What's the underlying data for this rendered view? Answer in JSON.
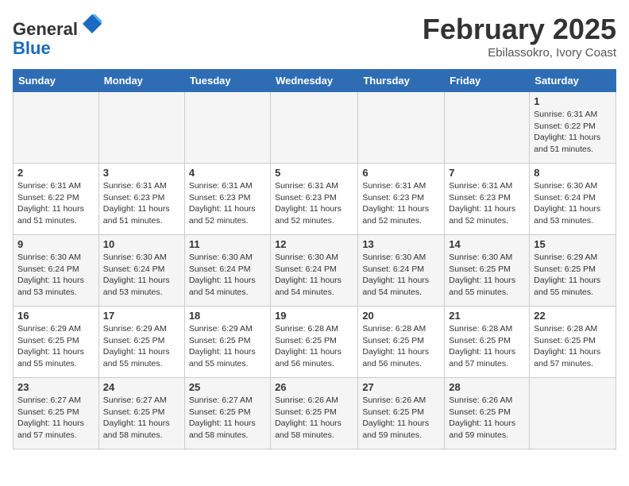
{
  "header": {
    "logo_general": "General",
    "logo_blue": "Blue",
    "month_year": "February 2025",
    "location": "Ebilassokro, Ivory Coast"
  },
  "weekdays": [
    "Sunday",
    "Monday",
    "Tuesday",
    "Wednesday",
    "Thursday",
    "Friday",
    "Saturday"
  ],
  "weeks": [
    [
      {
        "day": "",
        "info": ""
      },
      {
        "day": "",
        "info": ""
      },
      {
        "day": "",
        "info": ""
      },
      {
        "day": "",
        "info": ""
      },
      {
        "day": "",
        "info": ""
      },
      {
        "day": "",
        "info": ""
      },
      {
        "day": "1",
        "info": "Sunrise: 6:31 AM\nSunset: 6:22 PM\nDaylight: 11 hours and 51 minutes."
      }
    ],
    [
      {
        "day": "2",
        "info": "Sunrise: 6:31 AM\nSunset: 6:22 PM\nDaylight: 11 hours and 51 minutes."
      },
      {
        "day": "3",
        "info": "Sunrise: 6:31 AM\nSunset: 6:23 PM\nDaylight: 11 hours and 51 minutes."
      },
      {
        "day": "4",
        "info": "Sunrise: 6:31 AM\nSunset: 6:23 PM\nDaylight: 11 hours and 52 minutes."
      },
      {
        "day": "5",
        "info": "Sunrise: 6:31 AM\nSunset: 6:23 PM\nDaylight: 11 hours and 52 minutes."
      },
      {
        "day": "6",
        "info": "Sunrise: 6:31 AM\nSunset: 6:23 PM\nDaylight: 11 hours and 52 minutes."
      },
      {
        "day": "7",
        "info": "Sunrise: 6:31 AM\nSunset: 6:23 PM\nDaylight: 11 hours and 52 minutes."
      },
      {
        "day": "8",
        "info": "Sunrise: 6:30 AM\nSunset: 6:24 PM\nDaylight: 11 hours and 53 minutes."
      }
    ],
    [
      {
        "day": "9",
        "info": "Sunrise: 6:30 AM\nSunset: 6:24 PM\nDaylight: 11 hours and 53 minutes."
      },
      {
        "day": "10",
        "info": "Sunrise: 6:30 AM\nSunset: 6:24 PM\nDaylight: 11 hours and 53 minutes."
      },
      {
        "day": "11",
        "info": "Sunrise: 6:30 AM\nSunset: 6:24 PM\nDaylight: 11 hours and 54 minutes."
      },
      {
        "day": "12",
        "info": "Sunrise: 6:30 AM\nSunset: 6:24 PM\nDaylight: 11 hours and 54 minutes."
      },
      {
        "day": "13",
        "info": "Sunrise: 6:30 AM\nSunset: 6:24 PM\nDaylight: 11 hours and 54 minutes."
      },
      {
        "day": "14",
        "info": "Sunrise: 6:30 AM\nSunset: 6:25 PM\nDaylight: 11 hours and 55 minutes."
      },
      {
        "day": "15",
        "info": "Sunrise: 6:29 AM\nSunset: 6:25 PM\nDaylight: 11 hours and 55 minutes."
      }
    ],
    [
      {
        "day": "16",
        "info": "Sunrise: 6:29 AM\nSunset: 6:25 PM\nDaylight: 11 hours and 55 minutes."
      },
      {
        "day": "17",
        "info": "Sunrise: 6:29 AM\nSunset: 6:25 PM\nDaylight: 11 hours and 55 minutes."
      },
      {
        "day": "18",
        "info": "Sunrise: 6:29 AM\nSunset: 6:25 PM\nDaylight: 11 hours and 55 minutes."
      },
      {
        "day": "19",
        "info": "Sunrise: 6:28 AM\nSunset: 6:25 PM\nDaylight: 11 hours and 56 minutes."
      },
      {
        "day": "20",
        "info": "Sunrise: 6:28 AM\nSunset: 6:25 PM\nDaylight: 11 hours and 56 minutes."
      },
      {
        "day": "21",
        "info": "Sunrise: 6:28 AM\nSunset: 6:25 PM\nDaylight: 11 hours and 57 minutes."
      },
      {
        "day": "22",
        "info": "Sunrise: 6:28 AM\nSunset: 6:25 PM\nDaylight: 11 hours and 57 minutes."
      }
    ],
    [
      {
        "day": "23",
        "info": "Sunrise: 6:27 AM\nSunset: 6:25 PM\nDaylight: 11 hours and 57 minutes."
      },
      {
        "day": "24",
        "info": "Sunrise: 6:27 AM\nSunset: 6:25 PM\nDaylight: 11 hours and 58 minutes."
      },
      {
        "day": "25",
        "info": "Sunrise: 6:27 AM\nSunset: 6:25 PM\nDaylight: 11 hours and 58 minutes."
      },
      {
        "day": "26",
        "info": "Sunrise: 6:26 AM\nSunset: 6:25 PM\nDaylight: 11 hours and 58 minutes."
      },
      {
        "day": "27",
        "info": "Sunrise: 6:26 AM\nSunset: 6:25 PM\nDaylight: 11 hours and 59 minutes."
      },
      {
        "day": "28",
        "info": "Sunrise: 6:26 AM\nSunset: 6:25 PM\nDaylight: 11 hours and 59 minutes."
      },
      {
        "day": "",
        "info": ""
      }
    ]
  ]
}
